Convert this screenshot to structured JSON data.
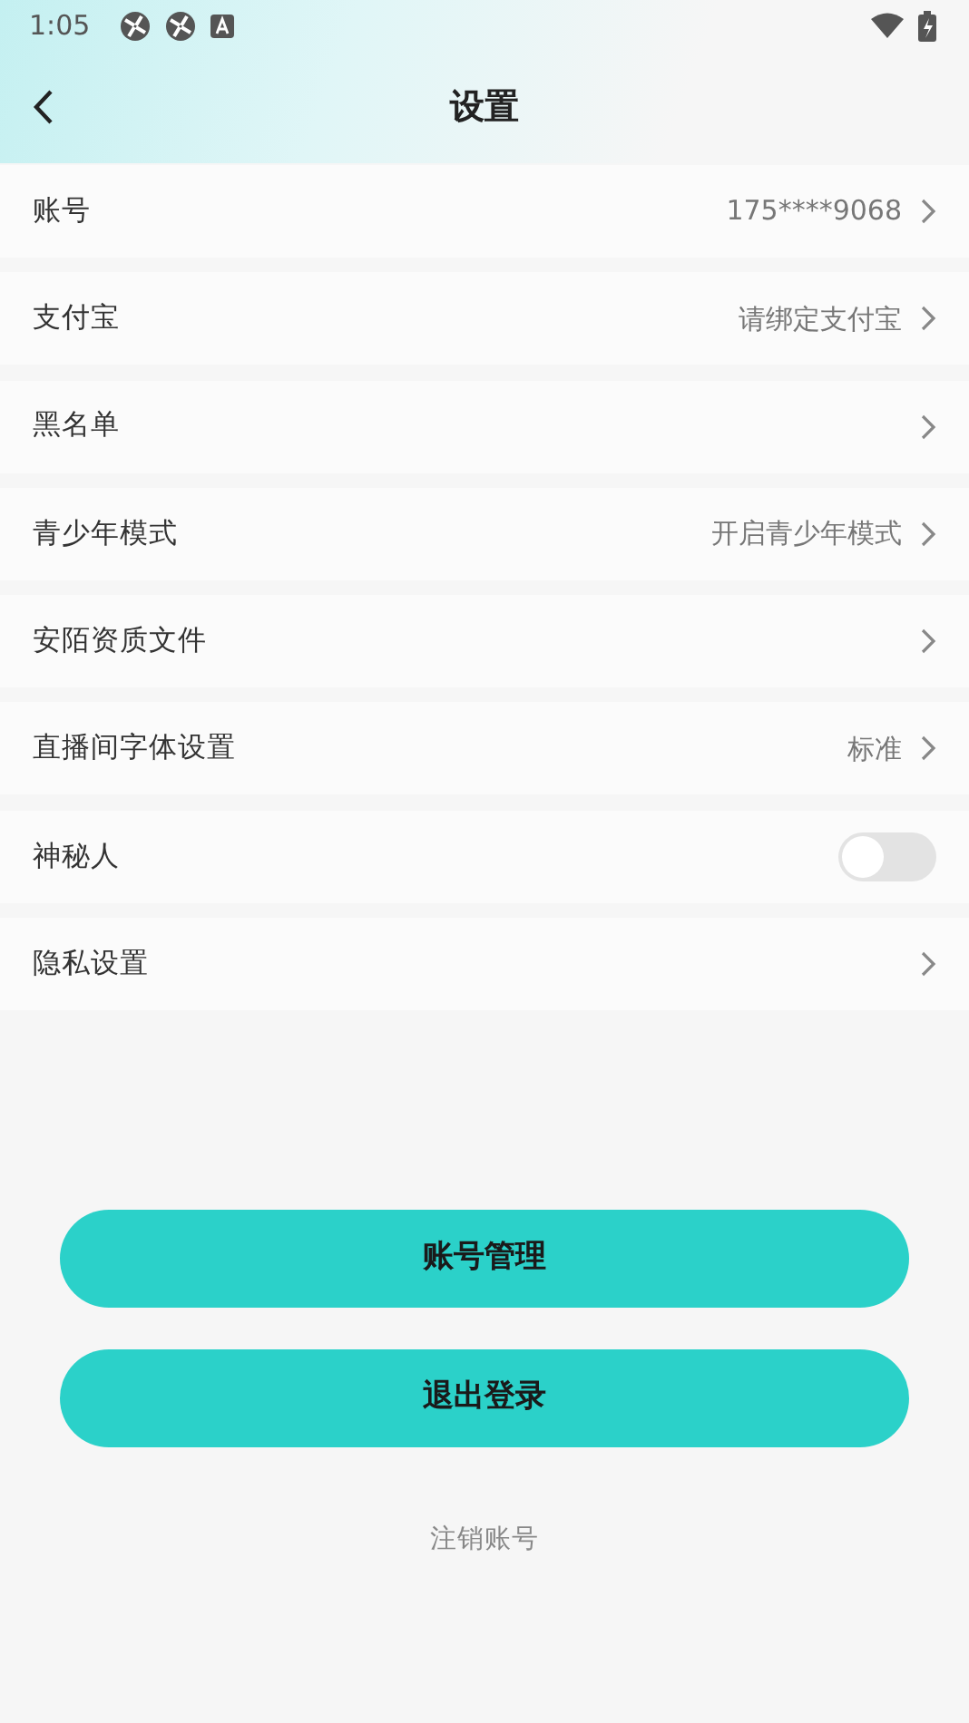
{
  "status_bar": {
    "time": "1:05"
  },
  "header": {
    "title": "设置"
  },
  "settings": [
    {
      "kind": "link",
      "label": "账号",
      "value": "175****9068"
    },
    {
      "kind": "link",
      "label": "支付宝",
      "value": "请绑定支付宝"
    },
    {
      "kind": "link",
      "label": "黑名单"
    },
    {
      "kind": "link",
      "label": "青少年模式",
      "value": "开启青少年模式"
    },
    {
      "kind": "link",
      "label": "安陌资质文件"
    },
    {
      "kind": "link",
      "label": "直播间字体设置",
      "value": "标准"
    },
    {
      "kind": "toggle",
      "label": "神秘人",
      "on": false
    },
    {
      "kind": "link",
      "label": "隐私设置"
    }
  ],
  "buttons": [
    "账号管理",
    "退出登录"
  ],
  "footer_link": "注销账号"
}
